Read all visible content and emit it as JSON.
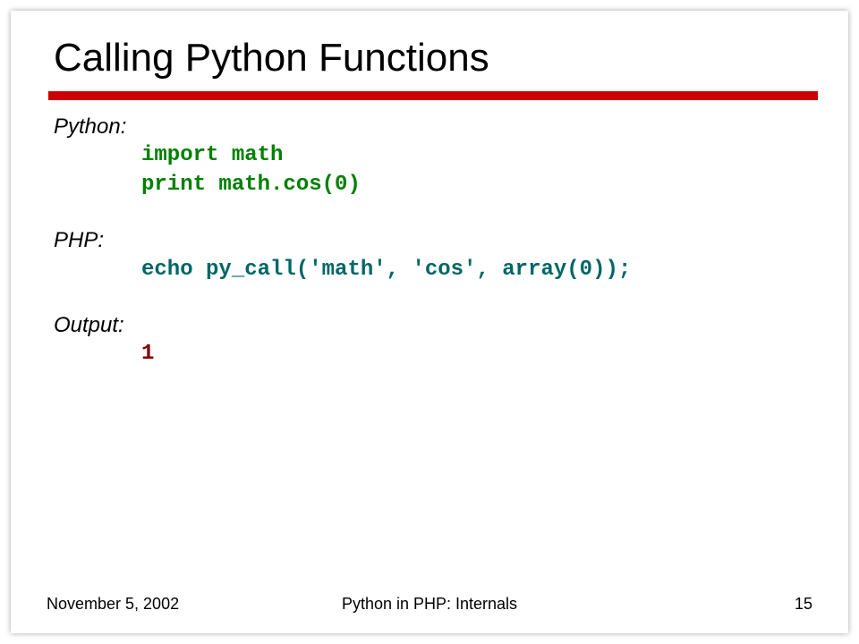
{
  "slide": {
    "title": "Calling Python Functions",
    "sections": {
      "python": {
        "label": "Python:",
        "line1": "import math",
        "line2": "print math.cos(0)"
      },
      "php": {
        "label": "PHP:",
        "line1": "echo py_call('math', 'cos', array(0));"
      },
      "output": {
        "label": "Output:",
        "line1": "1"
      }
    },
    "footer": {
      "date": "November 5, 2002",
      "title": "Python in PHP: Internals",
      "page": "15"
    }
  }
}
